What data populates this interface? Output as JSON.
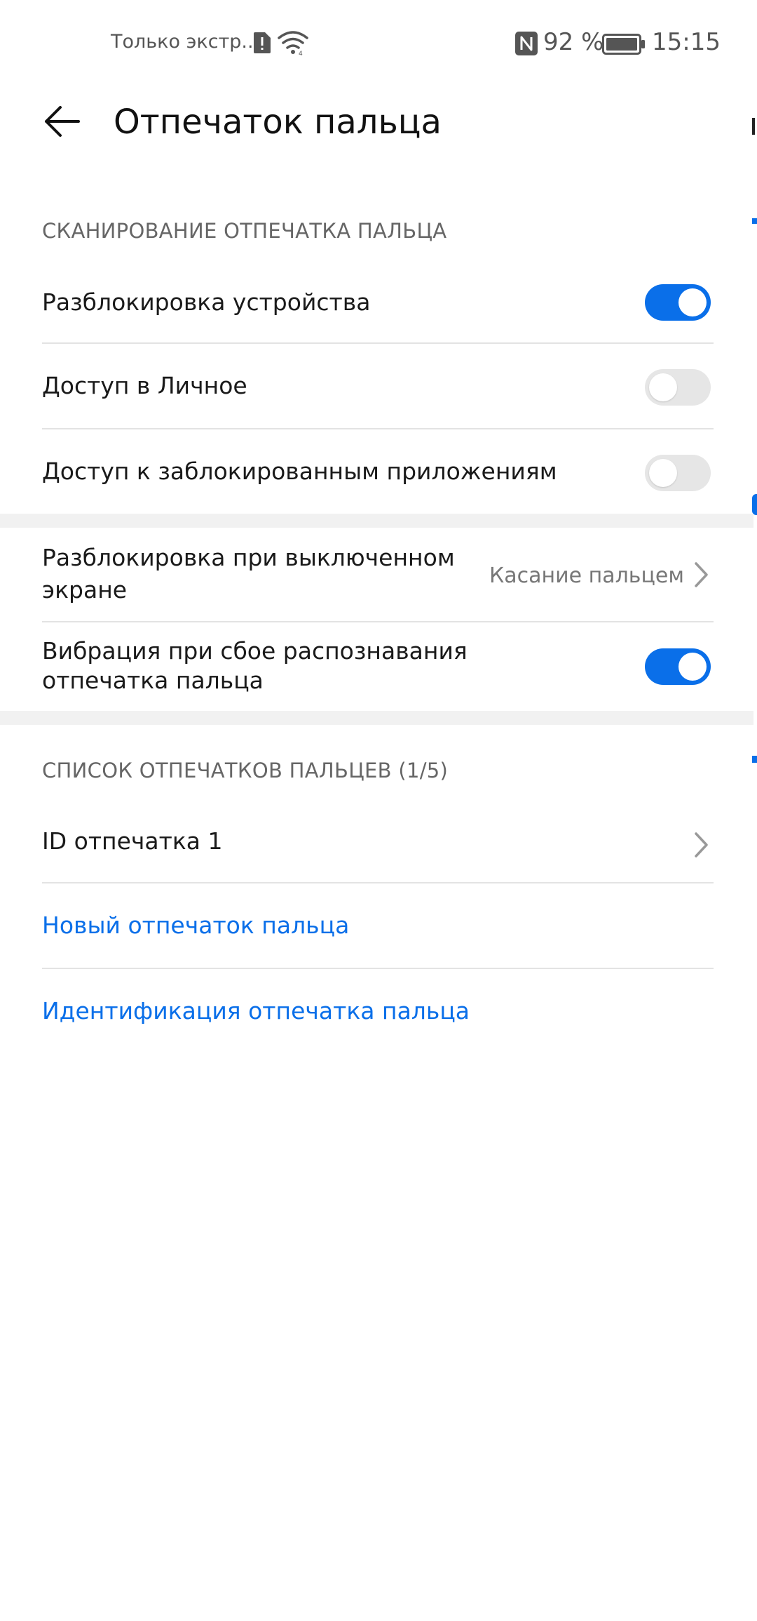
{
  "status_bar": {
    "carrier": "Только экстр....",
    "battery_percent": "92 %",
    "time": "15:15",
    "icons": [
      "sim-alert-icon",
      "wifi-icon",
      "nfc-icon",
      "battery-icon"
    ]
  },
  "app_bar": {
    "title": "Отпечаток пальца",
    "back_icon": "arrow-left-icon"
  },
  "section_scan": {
    "header": "СКАНИРОВАНИЕ ОТПЕЧАТКА ПАЛЬЦА",
    "items": [
      {
        "label": "Разблокировка устройства",
        "toggle": true
      },
      {
        "label": "Доступ в Личное",
        "toggle": false
      },
      {
        "label": "Доступ к заблокированным приложениям",
        "toggle": false
      }
    ]
  },
  "section_options": {
    "screen_off_unlock": {
      "label": "Разблокировка при выключенном экране",
      "value": "Касание пальцем"
    },
    "vibration": {
      "label": "Вибрация при сбое распознавания отпечатка пальца",
      "toggle": true
    }
  },
  "section_list": {
    "header": "СПИСОК ОТПЕЧАТКОВ ПАЛЬЦЕВ (1/5)",
    "fingerprints": [
      {
        "label": "ID отпечатка 1"
      }
    ],
    "new_fingerprint": "Новый отпечаток пальца",
    "identify": "Идентификация отпечатка пальца"
  },
  "colors": {
    "accent": "#0a6fe9",
    "toggle_off": "#e6e6e6",
    "divider": "#e3e3e3",
    "section_band": "#f1f1f1"
  }
}
